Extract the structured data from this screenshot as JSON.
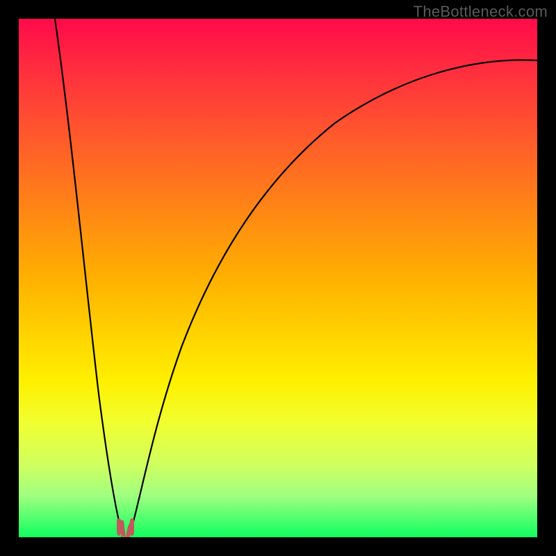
{
  "attribution": "TheBottleneck.com",
  "chart_data": {
    "type": "line",
    "title": "",
    "xlabel": "",
    "ylabel": "",
    "xlim": [
      0,
      100
    ],
    "ylim": [
      0,
      100
    ],
    "grid": false,
    "series": [
      {
        "name": "left-branch",
        "x": [
          7,
          10,
          13,
          15,
          17,
          19,
          20
        ],
        "values": [
          100,
          70,
          40,
          22,
          10,
          3,
          0
        ]
      },
      {
        "name": "right-branch",
        "x": [
          21,
          23,
          26,
          30,
          35,
          42,
          52,
          65,
          80,
          100
        ],
        "values": [
          0,
          6,
          18,
          33,
          48,
          62,
          73,
          82,
          87,
          90
        ]
      }
    ],
    "marker": {
      "name": "minimum-nub",
      "x_range": [
        19,
        22
      ],
      "y": 0,
      "color": "#c15a5a"
    },
    "background_gradient": {
      "top": "#ff0a4a",
      "bottom": "#10ff60"
    }
  }
}
